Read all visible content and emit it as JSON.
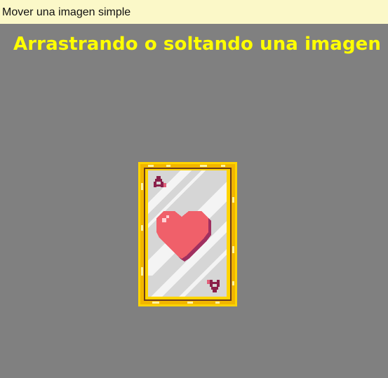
{
  "window": {
    "title": "Mover una imagen simple"
  },
  "scene": {
    "heading": "Arrastrando o soltando una imagen",
    "heading_color": "#ffff00",
    "background_color": "#808080"
  },
  "card": {
    "rank": "A",
    "suit": "hearts",
    "suit_icon": "heart-icon",
    "frame_color": "#f5c400",
    "face_color": "#d8d8d8",
    "suit_color": "#f0606a"
  }
}
